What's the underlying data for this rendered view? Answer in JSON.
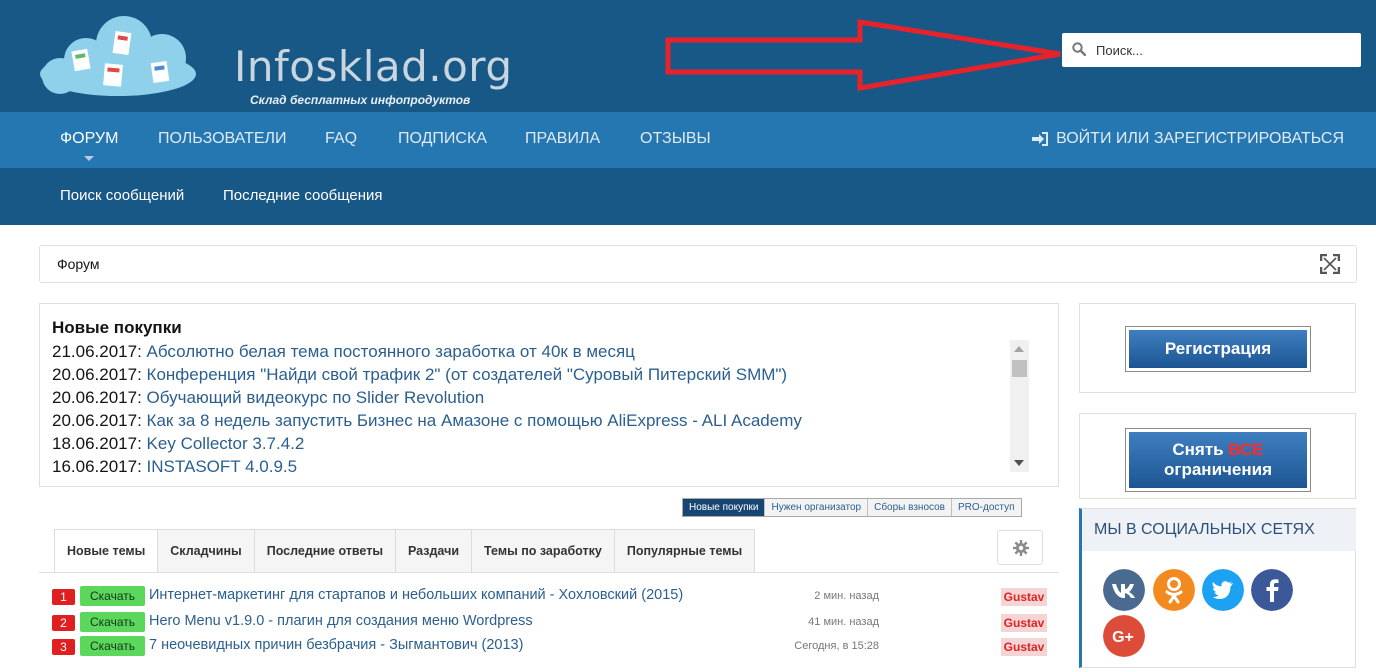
{
  "header": {
    "logo_text": "Infosklad.org",
    "logo_subtitle": "Склад бесплатных инфопродуктов",
    "search_placeholder": "Поиск..."
  },
  "nav": {
    "items": [
      "Форум",
      "Пользователи",
      "FAQ",
      "Подписка",
      "Правила",
      "Отзывы"
    ],
    "active": "Форум",
    "login_label": "Войти или зарегистрироваться"
  },
  "subnav": {
    "items": [
      "Поиск сообщений",
      "Последние сообщения"
    ]
  },
  "breadcrumb": {
    "label": "Форум"
  },
  "purchases": {
    "title": "Новые покупки",
    "items": [
      {
        "date": "21.06.2017:",
        "title": "Абсолютно белая тема постоянного заработка от 40к в месяц"
      },
      {
        "date": "20.06.2017:",
        "title": "Конференция \"Найди свой трафик 2\" (от создателей \"Суровый Питерский SMM\")"
      },
      {
        "date": "20.06.2017:",
        "title": "Обучающий видеокурс по Slider Revolution"
      },
      {
        "date": "20.06.2017:",
        "title": "Как за 8 недель запустить Бизнес на Амазоне с помощью AliExpress - ALI Academy"
      },
      {
        "date": "18.06.2017:",
        "title": "Key Collector 3.7.4.2"
      },
      {
        "date": "16.06.2017:",
        "title": "INSTASOFT 4.0.9.5"
      }
    ]
  },
  "small_tabs": [
    "Новые покупки",
    "Нужен организатор",
    "Сборы взносов",
    "PRO-доступ"
  ],
  "main_tabs": [
    "Новые темы",
    "Складчины",
    "Последние ответы",
    "Раздачи",
    "Темы по заработку",
    "Популярные темы"
  ],
  "topics": [
    {
      "num": "1",
      "download": "Скачать",
      "title": "Интернет-маркетинг для стартапов и небольших компаний - Хохловский (2015)",
      "time": "2 мин. назад",
      "user": "Gustav"
    },
    {
      "num": "2",
      "download": "Скачать",
      "title": "Hero Menu v1.9.0 - плагин для создания меню Wordpress",
      "time": "41 мин. назад",
      "user": "Gustav"
    },
    {
      "num": "3",
      "download": "Скачать",
      "title": "7 неочевидных причин безбрачия - Зыгмантович (2013)",
      "time": "Сегодня, в 15:28",
      "user": "Gustav"
    }
  ],
  "sidebar": {
    "register_label": "Регистрация",
    "unlock_label_1": "Снять",
    "unlock_label_highlight": "ВСЕ",
    "unlock_label_2": "ограничения",
    "social_title": "Мы в социальных сетях",
    "social": [
      {
        "name": "vk-icon",
        "color": "#4a6b8f",
        "glyph": "vk"
      },
      {
        "name": "odnoklassniki-icon",
        "color": "#f28a20",
        "glyph": "ok"
      },
      {
        "name": "twitter-icon",
        "color": "#1da1f2",
        "glyph": "tw"
      },
      {
        "name": "facebook-icon",
        "color": "#3b5998",
        "glyph": "f"
      },
      {
        "name": "google-plus-icon",
        "color": "#dd4b39",
        "glyph": "G+"
      }
    ]
  },
  "colors": {
    "header_bg": "#185886",
    "nav_bg": "#2577b1",
    "link": "#2b5f8f",
    "badge_red": "#e02020",
    "download_green": "#5bd75b"
  }
}
